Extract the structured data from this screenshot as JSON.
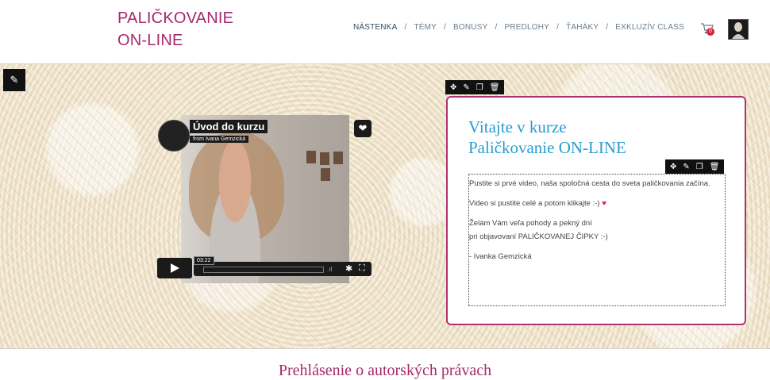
{
  "brand": {
    "line1": "PALIČKOVANIE",
    "line2": "ON-LINE"
  },
  "nav": {
    "items": [
      "NÁSTENKA",
      "TÉMY",
      "BONUSY",
      "PREDLOHY",
      "ŤAHÁKY",
      "EXKLUZÍV CLASS"
    ],
    "separator": "/",
    "cart_count": "0"
  },
  "video": {
    "title": "Úvod do kurzu",
    "from": "from Ivana Gemzická",
    "time": "03:22"
  },
  "card": {
    "title_line1": "Vitajte v kurze",
    "title_line2": "Paličkovanie ON-LINE",
    "p1": "Pustite si prvé video, naša spoločná cesta do sveta paličkovania začína.",
    "p2": "Video si pustite celé a potom klikajte :-)",
    "p2_heart": "♥",
    "p3a": "Želám Vám veľa pohody a pekný dní",
    "p3b": "pri objavovaní PALIČKOVANEJ ČIPKY :-)",
    "p4": "- Ivanka Gemzická"
  },
  "bottom_title": "Prehlásenie o autorských právach",
  "icons": {
    "edit": "pencil-icon",
    "move": "move-icon",
    "copy": "copy-icon",
    "delete": "trash-icon",
    "cart": "cart-icon",
    "heart": "heart-icon",
    "play": "play-icon",
    "settings": "gear-icon",
    "fullscreen": "fullscreen-icon"
  },
  "colors": {
    "brand": "#a52a6b",
    "title": "#2a9ccf",
    "border": "#b0336f"
  }
}
